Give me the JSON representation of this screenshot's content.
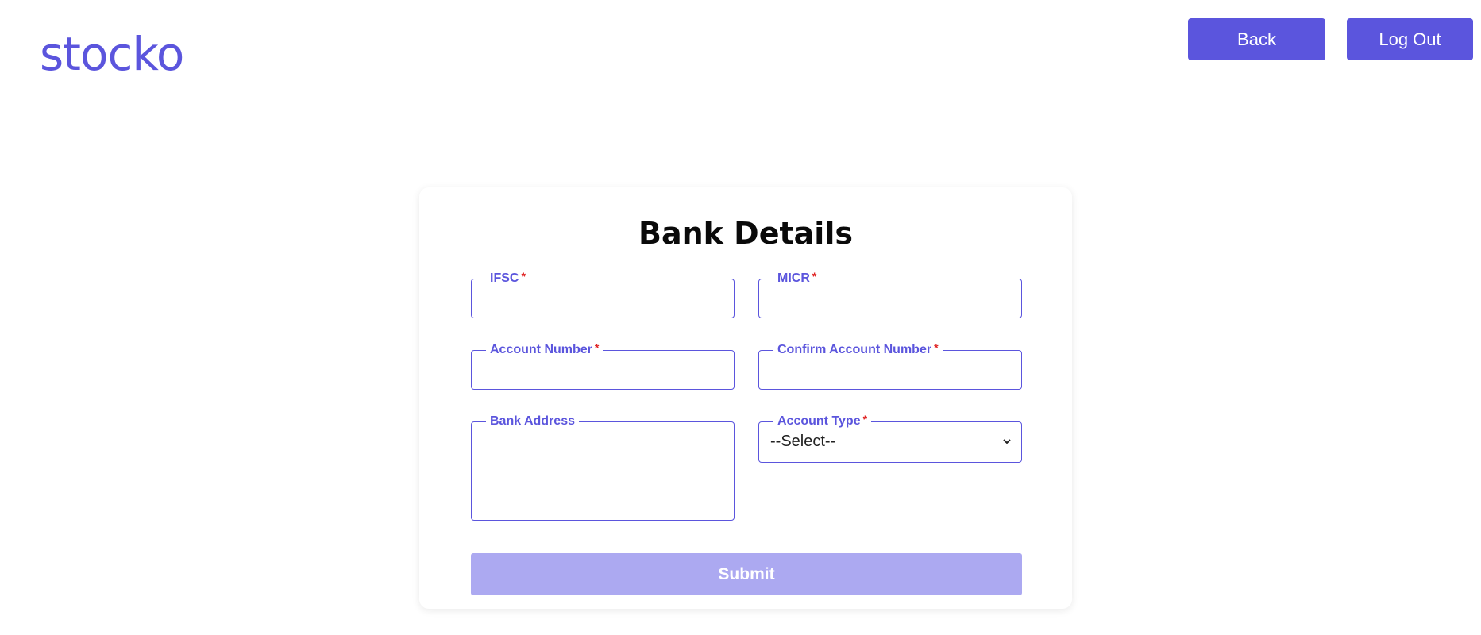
{
  "header": {
    "logo": "stocko",
    "back_label": "Back",
    "logout_label": "Log Out"
  },
  "form": {
    "title": "Bank Details",
    "required_mark": "*",
    "ifsc": {
      "label": "IFSC",
      "value": ""
    },
    "micr": {
      "label": "MICR",
      "value": ""
    },
    "account_number": {
      "label": "Account Number",
      "value": ""
    },
    "confirm_account_number": {
      "label": "Confirm Account Number",
      "value": ""
    },
    "bank_address": {
      "label": "Bank Address",
      "value": ""
    },
    "account_type": {
      "label": "Account Type",
      "selected": "--Select--"
    },
    "submit_label": "Submit"
  },
  "colors": {
    "accent": "#5b55dd",
    "submit_disabled": "#aca9f1",
    "required": "#e02424"
  }
}
